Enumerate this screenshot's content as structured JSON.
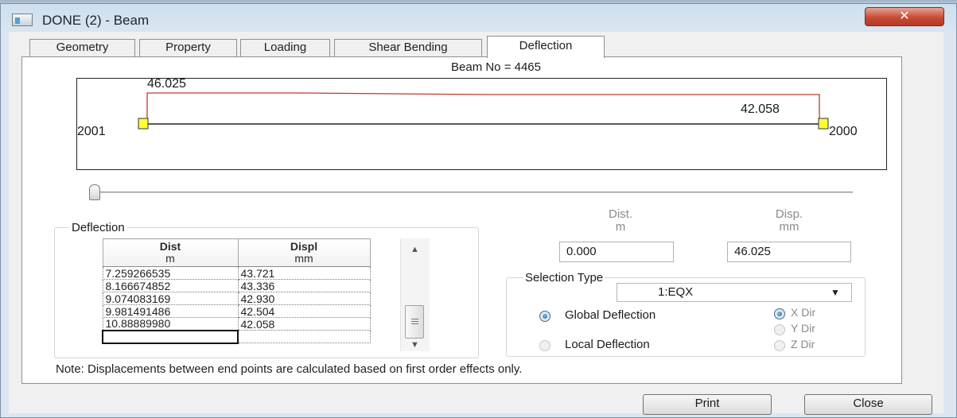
{
  "window": {
    "title": "DONE (2) - Beam",
    "close_glyph": "✕"
  },
  "tabs": [
    {
      "label": "Geometry",
      "active": false
    },
    {
      "label": "Property",
      "active": false
    },
    {
      "label": "Loading",
      "active": false
    },
    {
      "label": "Shear Bending",
      "active": false
    },
    {
      "label": "Deflection",
      "active": true
    }
  ],
  "beam": {
    "beam_no_label": "Beam No = 4465",
    "left_deflection": "46.025",
    "right_deflection": "42.058",
    "left_node": "2001",
    "right_node": "2000",
    "slider_position": 0
  },
  "deflection_group": {
    "label": "Deflection",
    "columns": [
      {
        "line1": "Dist",
        "line2": "m"
      },
      {
        "line1": "Displ",
        "line2": "mm"
      }
    ],
    "rows": [
      [
        "7.259266535",
        "43.721"
      ],
      [
        "8.166674852",
        "43.336"
      ],
      [
        "9.074083169",
        "42.930"
      ],
      [
        "9.981491486",
        "42.504"
      ],
      [
        "10.88889980",
        "42.058"
      ],
      [
        "",
        ""
      ]
    ]
  },
  "readout": {
    "dist_label_1": "Dist.",
    "dist_label_2": "m",
    "disp_label_1": "Disp.",
    "disp_label_2": "mm",
    "dist_value": "0.000",
    "disp_value": "46.025"
  },
  "selection_type": {
    "label": "Selection Type",
    "selected": "1:EQX",
    "deflection_options": [
      {
        "label": "Global Deflection",
        "checked": true
      },
      {
        "label": "Local Deflection",
        "checked": false
      }
    ],
    "dir_options": [
      {
        "label": "X Dir",
        "checked": true
      },
      {
        "label": "Y Dir",
        "checked": false
      },
      {
        "label": "Z Dir",
        "checked": false
      }
    ]
  },
  "note": "Note: Displacements between end points are calculated based on first order effects only.",
  "buttons": {
    "print": "Print",
    "close": "Close"
  },
  "colors": {
    "curve": "#c0392b",
    "support": "#ffff33",
    "accent": "#3b6e96"
  }
}
